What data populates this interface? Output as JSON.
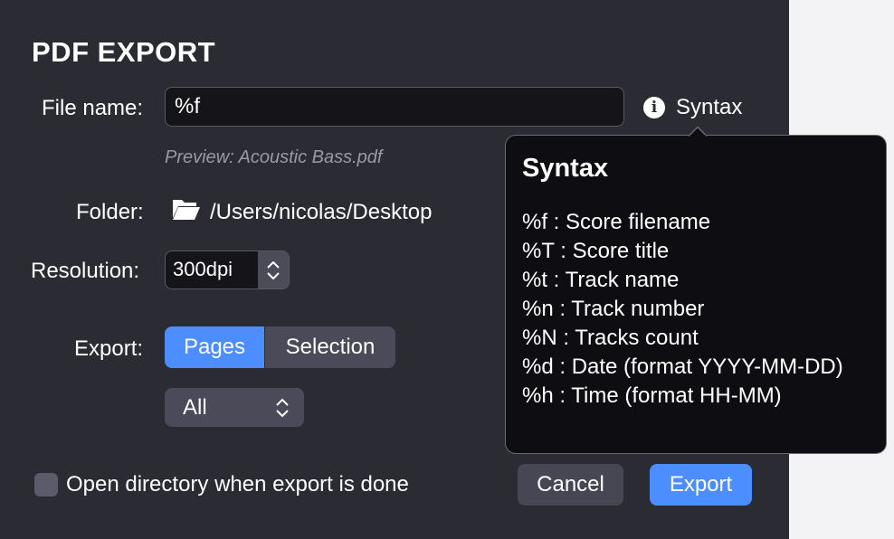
{
  "dialog": {
    "title": "PDF EXPORT",
    "file_name_label": "File name:",
    "file_name_value": "%f",
    "syntax_link": "Syntax",
    "preview": "Preview: Acoustic Bass.pdf",
    "folder_label": "Folder:",
    "folder_path": "/Users/nicolas/Desktop",
    "resolution_label": "Resolution:",
    "resolution_value": "300dpi",
    "export_label": "Export:",
    "export_segments": [
      "Pages",
      "Selection"
    ],
    "export_selected": "Pages",
    "pages_select_value": "All",
    "open_directory_label": "Open directory when export is done",
    "open_directory_checked": false,
    "cancel_label": "Cancel",
    "export_button_label": "Export"
  },
  "syntax_popover": {
    "title": "Syntax",
    "items": [
      "%f : Score filename",
      "%T : Score title",
      "%t : Track name",
      "%n : Track number",
      "%N : Tracks count",
      "%d : Date (format YYYY-MM-DD)",
      "%h : Time (format HH-MM)"
    ]
  },
  "colors": {
    "dialog_bg": "#2b2b34",
    "accent": "#4c8eff",
    "popover_bg": "#0e0e12"
  },
  "icons": {
    "info": "info-circle-icon",
    "folder": "open-folder-icon",
    "stepper": "stepper-arrows-icon",
    "select": "up-down-chevron-icon"
  }
}
